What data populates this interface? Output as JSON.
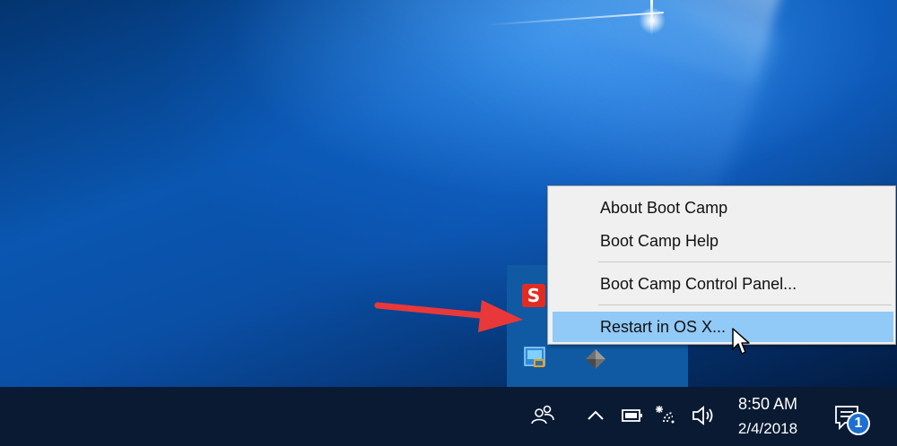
{
  "tray_overflow": {
    "icons": [
      {
        "name": "snagit-icon",
        "glyph": "S"
      },
      {
        "name": "intel-graphics-icon"
      },
      {
        "name": "boot-camp-icon"
      }
    ]
  },
  "context_menu": {
    "items": [
      {
        "label": "About Boot Camp"
      },
      {
        "label": "Boot Camp Help"
      },
      {
        "label": "Boot Camp Control Panel..."
      },
      {
        "label": "Restart in OS X...",
        "highlighted": true
      }
    ]
  },
  "taskbar": {
    "clock": {
      "time": "8:50 AM",
      "date": "2/4/2018"
    },
    "notification_count": "1",
    "icons": [
      "people-icon",
      "chevron-up-icon",
      "battery-icon",
      "wifi-icon",
      "volume-icon",
      "action-center-icon"
    ]
  },
  "colors": {
    "highlight": "#91c9f7",
    "taskbar": "#0a1a33",
    "flyout": "#0f5aa3",
    "arrow": "#e8383a"
  }
}
